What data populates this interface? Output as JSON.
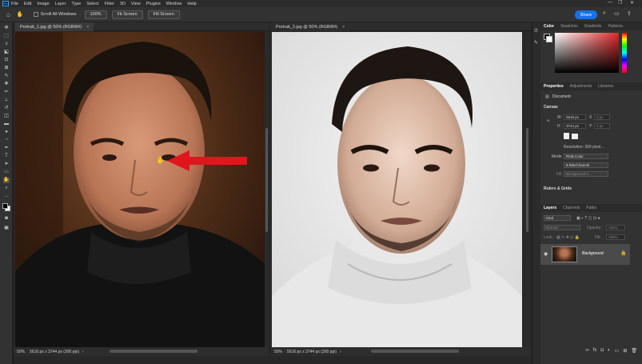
{
  "menubar": {
    "logo": "Ps",
    "items": [
      "File",
      "Edit",
      "Image",
      "Layer",
      "Type",
      "Select",
      "Filter",
      "3D",
      "View",
      "Plugins",
      "Window",
      "Help"
    ],
    "window_controls": [
      "—",
      "❐",
      "✕"
    ]
  },
  "options_bar": {
    "scroll_all_label": "Scroll All Windows",
    "zoom_100": "100%",
    "fit_screen": "Fit Screen",
    "fill_screen": "Fill Screen",
    "share_label": "Share"
  },
  "documents": [
    {
      "tab_label": "Portrait_1.jpg @ 50% (RGB/8#)",
      "close": "×",
      "zoom": "50%",
      "info": "5616 px x 3744 px (300 ppi)"
    },
    {
      "tab_label": "Portrait_2.jpg @ 50% (RGB/8#)",
      "close": "×",
      "zoom": "50%",
      "info": "5616 px x 3744 px (300 ppi)"
    }
  ],
  "color_panel": {
    "tabs": [
      "Color",
      "Swatches",
      "Gradients",
      "Patterns"
    ],
    "accent_color": "#e0282a"
  },
  "properties_panel": {
    "tabs": [
      "Properties",
      "Adjustments",
      "Libraries"
    ],
    "document_label": "Document",
    "canvas_section": "Canvas",
    "w_label": "W",
    "w_value": "5616 px",
    "h_label": "H",
    "h_value": "3744 px",
    "x_label": "X",
    "x_value": "0 px",
    "y_label": "Y",
    "y_value": "0 px",
    "resolution": "Resolution: 300 pixel...",
    "mode_label": "Mode",
    "mode_value": "RGB Color",
    "depth_value": "8 Bits/Channel",
    "fill_label": "Fill",
    "fill_value": "Background C...",
    "rulers_section": "Rulers & Grids"
  },
  "layers_panel": {
    "tabs": [
      "Layers",
      "Channels",
      "Paths"
    ],
    "kind_label": "Kind",
    "blend_mode": "Normal",
    "opacity_label": "Opacity:",
    "opacity_value": "100%",
    "lock_label": "Lock:",
    "fill_label": "Fill:",
    "fill_value": "100%",
    "layer_name": "Background"
  }
}
